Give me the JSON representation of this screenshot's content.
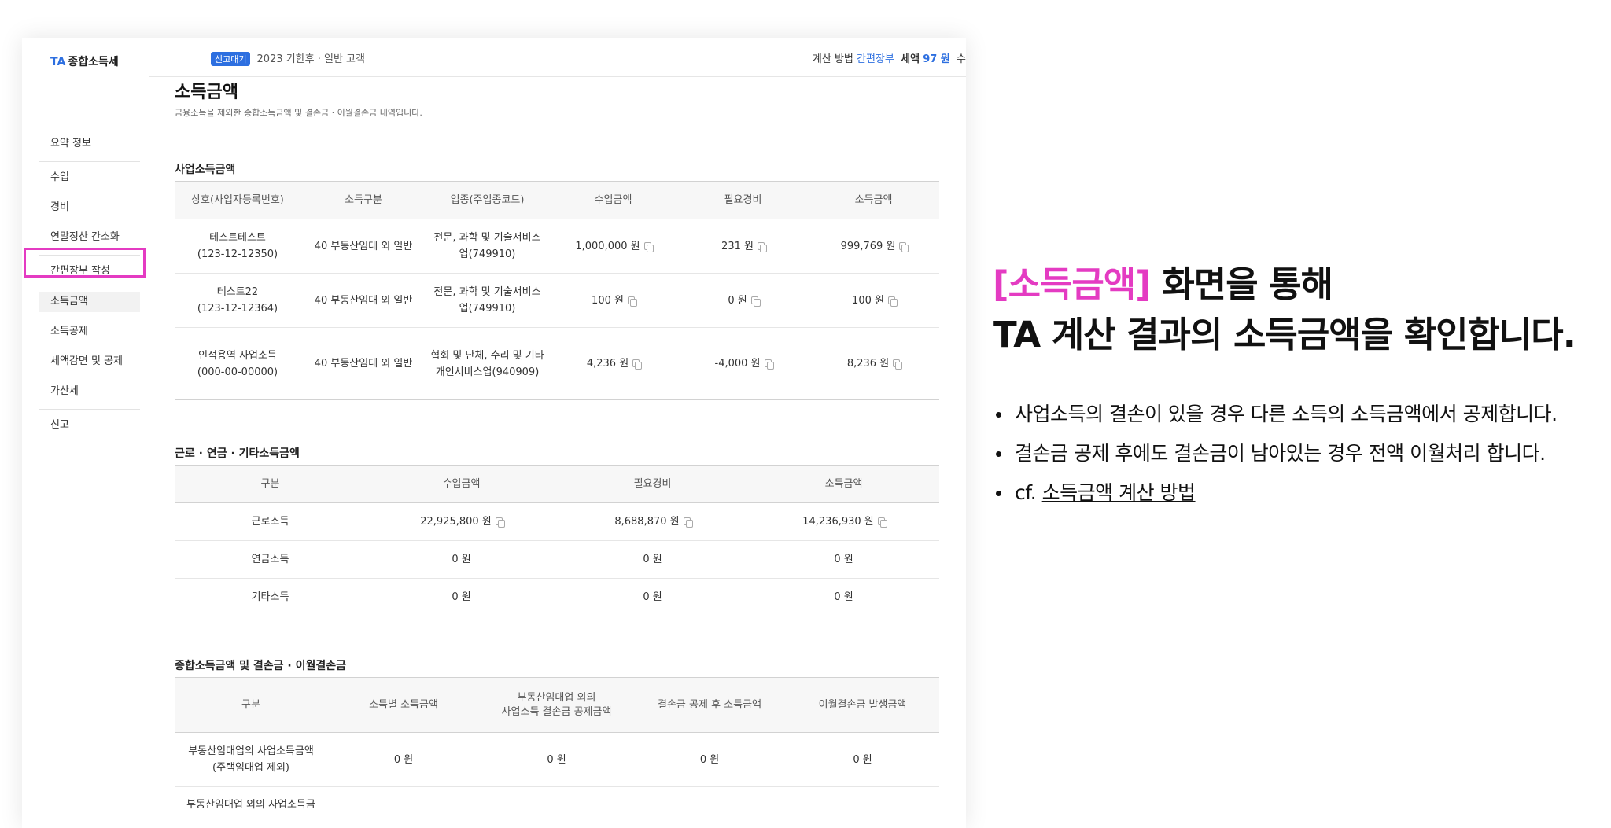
{
  "sidebar": {
    "brand_prefix": "TA",
    "brand_title": "종합소득세",
    "items": [
      {
        "label": "요약 정보"
      },
      {
        "label": "수입"
      },
      {
        "label": "경비"
      },
      {
        "label": "연말정산 간소화"
      },
      {
        "label": "간편장부 작성"
      },
      {
        "label": "소득금액"
      },
      {
        "label": "소득공제"
      },
      {
        "label": "세액감면 및 공제"
      },
      {
        "label": "가산세"
      },
      {
        "label": "신고"
      }
    ]
  },
  "topbar": {
    "badge": "신고대기",
    "info": "2023 기한후 · 일반 고객",
    "method_label": "계산 방법",
    "method_value": "간편장부",
    "tax_label": "세액",
    "tax_value": "97 원",
    "trailing": "수"
  },
  "page": {
    "title": "소득금액",
    "desc": "금융소득을 제외한 종합소득금액 및 결손금 · 이월결손금 내역입니다."
  },
  "business": {
    "title": "사업소득금액",
    "headers": [
      "상호(사업자등록번호)",
      "소득구분",
      "업종(주업종코드)",
      "수입금액",
      "필요경비",
      "소득금액"
    ],
    "rows": [
      {
        "name": "테스트테스트",
        "reg": "(123-12-12350)",
        "type": "40 부동산임대 외 일반",
        "industry": "전문, 과학 및 기술서비스업(749910)",
        "revenue": "1,000,000 원",
        "expense": "231 원",
        "income": "999,769 원"
      },
      {
        "name": "테스트22",
        "reg": "(123-12-12364)",
        "type": "40 부동산임대 외 일반",
        "industry": "전문, 과학 및 기술서비스업(749910)",
        "revenue": "100 원",
        "expense": "0 원",
        "income": "100 원"
      },
      {
        "name": "인적용역 사업소득",
        "reg": "(000-00-00000)",
        "type": "40 부동산임대 외 일반",
        "industry": "협회 및 단체, 수리 및 기타 개인서비스업(940909)",
        "revenue": "4,236 원",
        "expense": "-4,000 원",
        "income": "8,236 원"
      }
    ]
  },
  "labor": {
    "title": "근로 · 연금 · 기타소득금액",
    "headers": [
      "구분",
      "수입금액",
      "필요경비",
      "소득금액"
    ],
    "rows": [
      {
        "label": "근로소득",
        "revenue": "22,925,800 원",
        "expense": "8,688,870 원",
        "income": "14,236,930 원"
      },
      {
        "label": "연금소득",
        "revenue": "0 원",
        "expense": "0 원",
        "income": "0 원"
      },
      {
        "label": "기타소득",
        "revenue": "0 원",
        "expense": "0 원",
        "income": "0 원"
      }
    ]
  },
  "total": {
    "title": "종합소득금액 및 결손금 · 이월결손금",
    "headers": [
      "구분",
      "소득별 소득금액",
      "부동산임대업 외의",
      "사업소득 결손금 공제금액",
      "결손금 공제 후 소득금액",
      "이월결손금 발생금액"
    ],
    "rows": [
      {
        "label1": "부동산임대업의 사업소득금액",
        "label2": "(주택임대업 제외)",
        "c1": "0 원",
        "c2": "0 원",
        "c3": "0 원",
        "c4": "0 원"
      },
      {
        "label1": "부동산임대업 외의 사업소득금",
        "label2": "",
        "c1": "",
        "c2": "",
        "c3": "",
        "c4": ""
      }
    ]
  },
  "explain": {
    "line1_highlight": "[소득금액]",
    "line1_rest": " 화면을 통해",
    "line2": "TA 계산 결과의 소득금액을 확인합니다.",
    "bullets": [
      "사업소득의 결손이 있을 경우 다른 소득의 소득금액에서 공제합니다.",
      "결손금 공제 후에도 결손금이 남아있는 경우 전액 이월처리 합니다."
    ],
    "cf_prefix": "cf.",
    "cf_link": "소득금액 계산 방법"
  },
  "colors": {
    "accent": "#2d6fe0",
    "highlight": "#e43bc2"
  }
}
